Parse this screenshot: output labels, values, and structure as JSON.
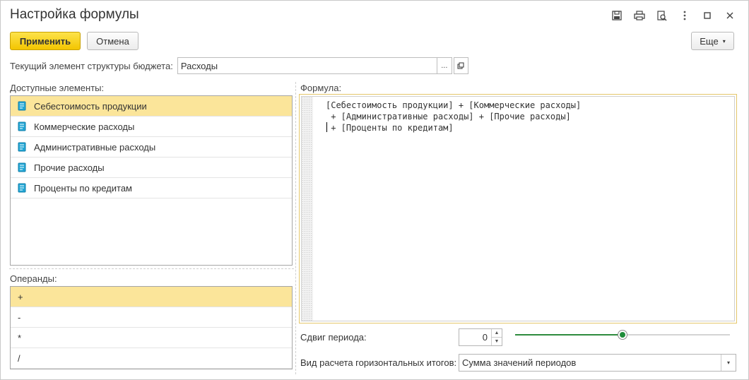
{
  "window": {
    "title": "Настройка формулы"
  },
  "toolbar": {
    "apply_label": "Применить",
    "cancel_label": "Отмена",
    "more_label": "Еще",
    "more_caret": "▾"
  },
  "current_element": {
    "label": "Текущий элемент структуры бюджета:",
    "value": "Расходы",
    "select_button": "...",
    "open_icon": "open-window-icon"
  },
  "available": {
    "label": "Доступные элементы:",
    "items": [
      {
        "label": "Себестоимость продукции",
        "selected": true
      },
      {
        "label": "Коммерческие расходы",
        "selected": false
      },
      {
        "label": "Административные расходы",
        "selected": false
      },
      {
        "label": "Прочие расходы",
        "selected": false
      },
      {
        "label": "Проценты по кредитам",
        "selected": false
      }
    ]
  },
  "operands": {
    "label": "Операнды:",
    "items": [
      {
        "label": "+",
        "selected": true
      },
      {
        "label": "-",
        "selected": false
      },
      {
        "label": "*",
        "selected": false
      },
      {
        "label": "/",
        "selected": false
      }
    ]
  },
  "formula": {
    "label": "Формула:",
    "text": "[Себестоимость продукции] + [Коммерческие расходы]\n + [Административные расходы] + [Прочие расходы]\n + [Проценты по кредитам]"
  },
  "period_shift": {
    "label": "Сдвиг периода:",
    "value": "0",
    "up": "▲",
    "down": "▼",
    "slider_fraction": 0.5
  },
  "horizontal_totals": {
    "label": "Вид расчета горизонтальных итогов:",
    "value": "Сумма значений периодов",
    "dropdown_arrow": "▾"
  },
  "colors": {
    "accent_yellow": "#f3c500",
    "selection": "#fbe59a",
    "slider_green": "#1f8c3a"
  }
}
